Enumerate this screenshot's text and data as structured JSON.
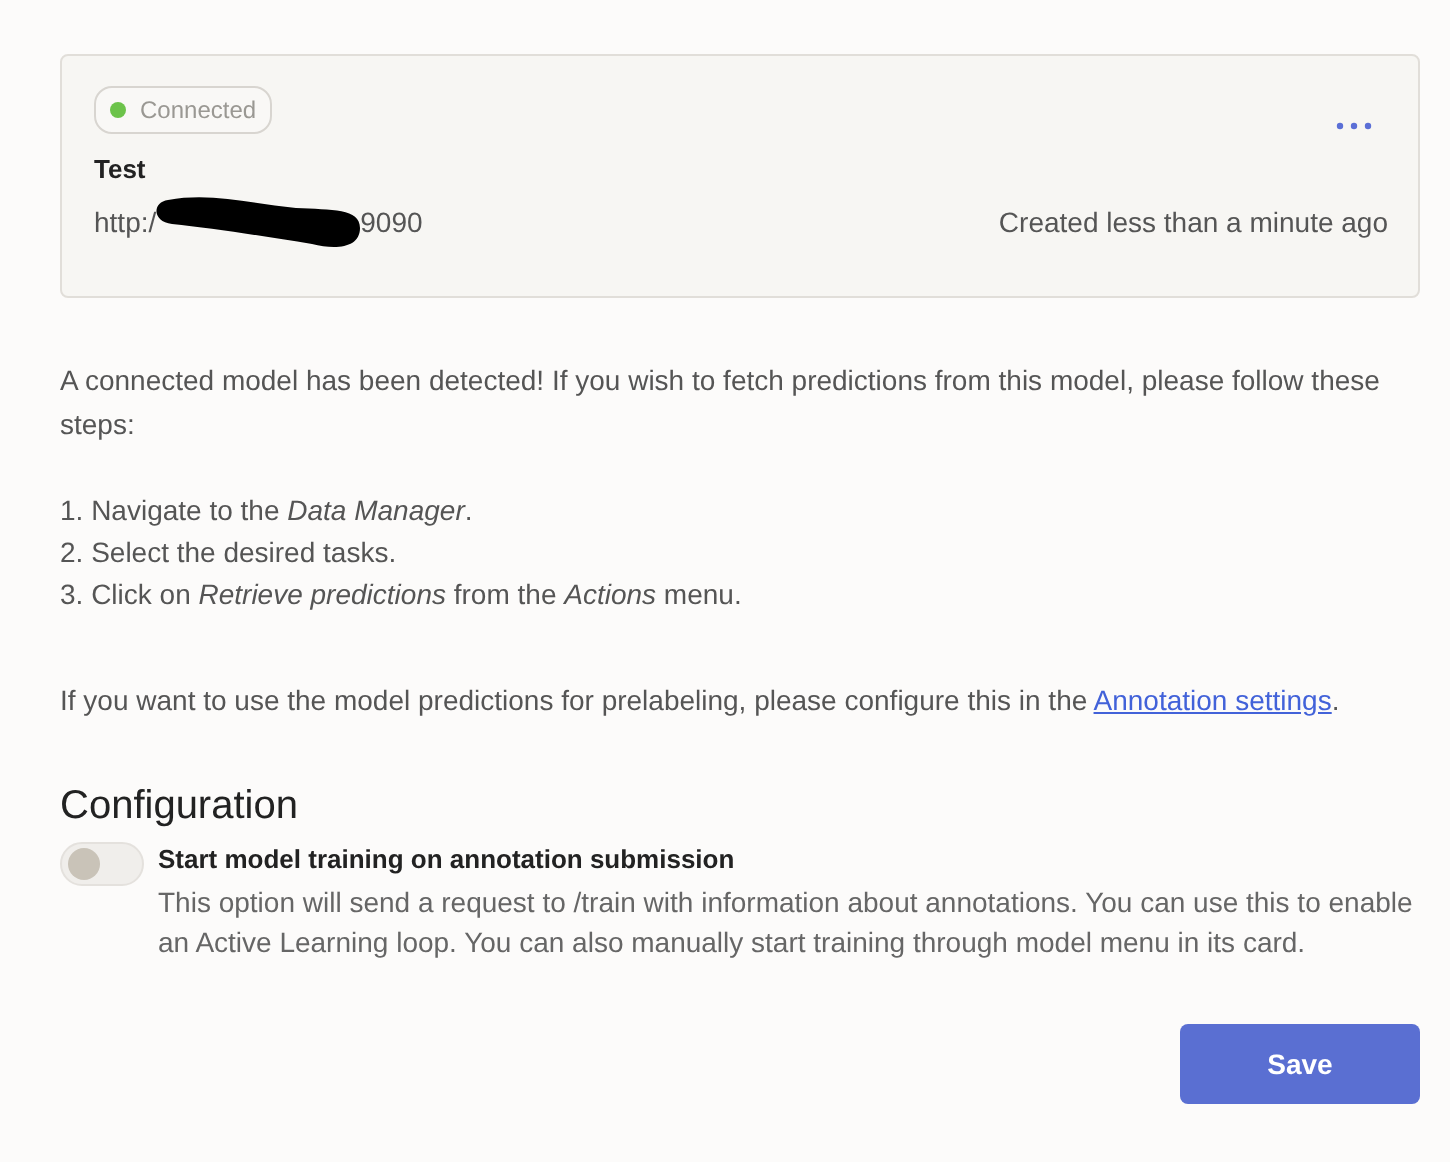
{
  "model_card": {
    "status": {
      "label": "Connected",
      "color": "#6cc34a"
    },
    "name": "Test",
    "url_start": "http:/",
    "url_redacted": true,
    "url_end": "9090",
    "created": "Created less than a minute ago"
  },
  "intro": "A connected model has been detected! If you wish to fetch predictions from this model, please follow these steps:",
  "steps": [
    "1. Navigate to the *Data Manager*.",
    "2. Select the desired tasks.",
    "3. Click on *Retrieve predictions* from the *Actions* menu."
  ],
  "prelabel_note": {
    "before": "If you want to use the model predictions for prelabeling, please configure this in the ",
    "link": "Annotation settings",
    "after": "."
  },
  "configuration": {
    "title": "Configuration",
    "options": [
      {
        "label": "Start model training on annotation submission",
        "on": false,
        "description": "This option will send a request to /train with information about annotations. You can use this to enable an Active Learning loop. You can also manually start training through model menu in its card."
      }
    ]
  },
  "buttons": [
    "Save"
  ]
}
